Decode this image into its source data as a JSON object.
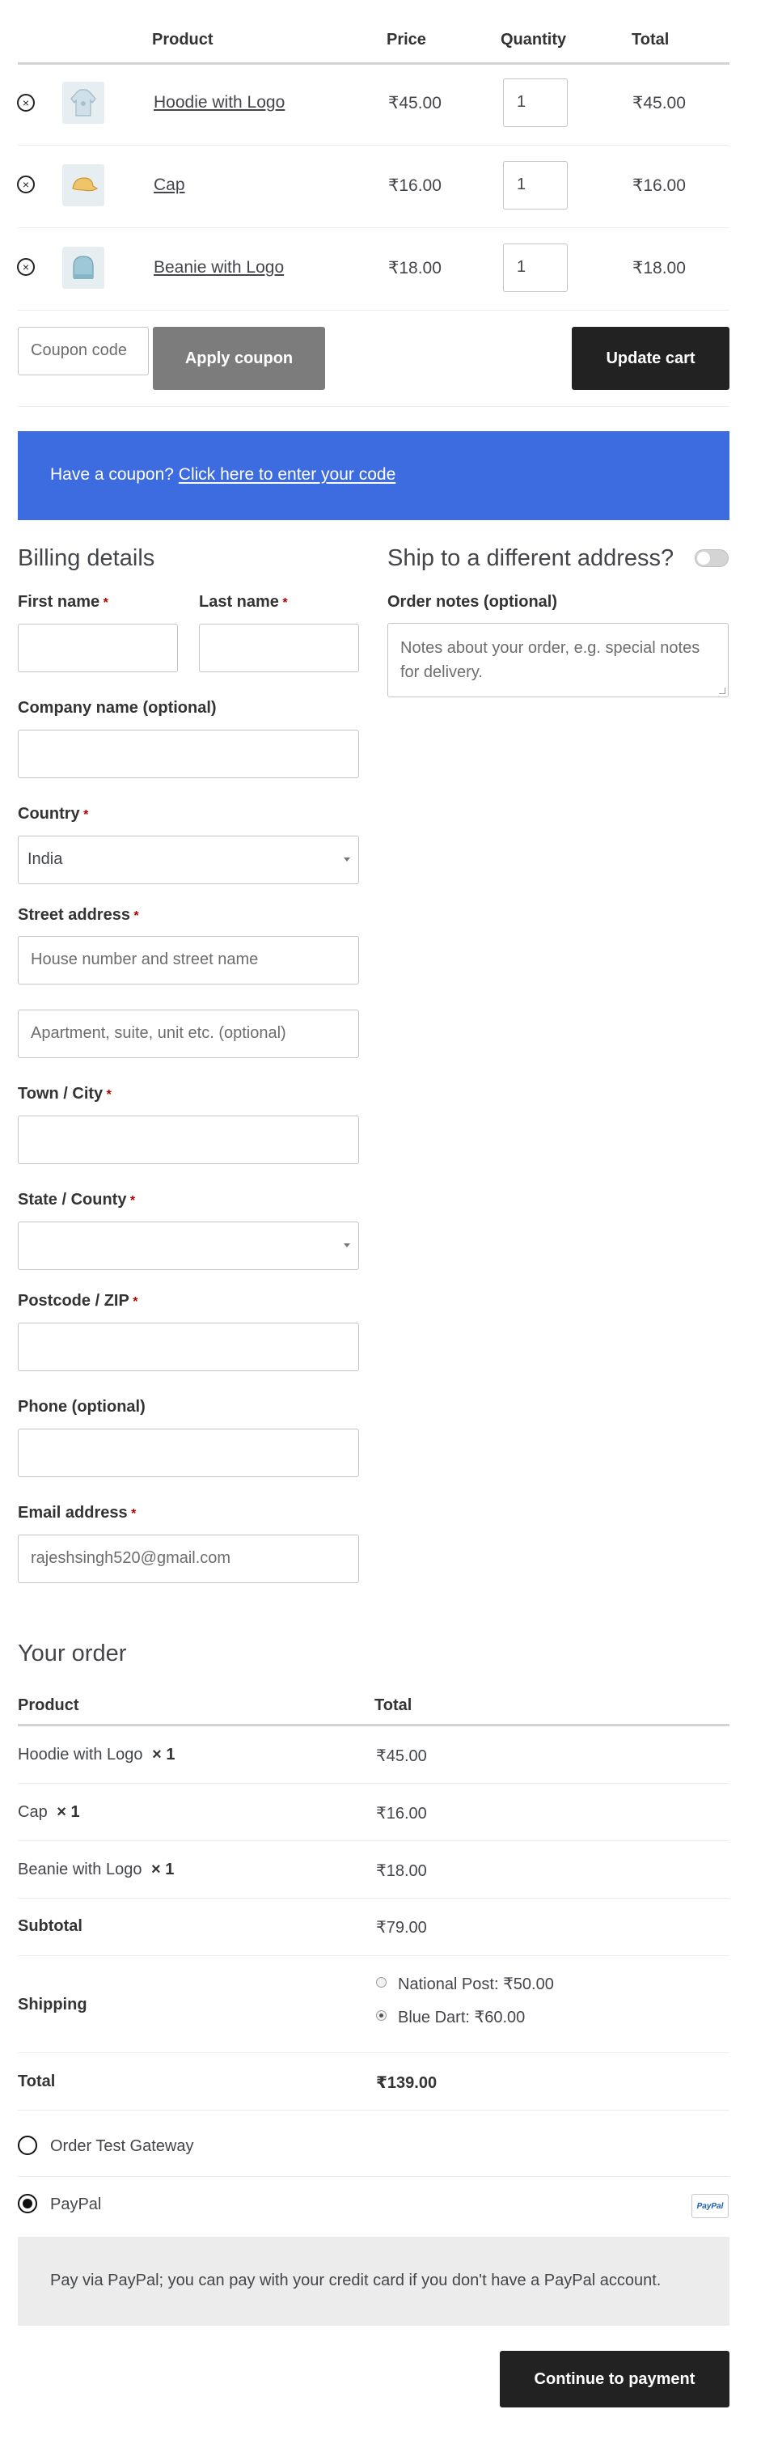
{
  "cart": {
    "headers": {
      "product": "Product",
      "price": "Price",
      "quantity": "Quantity",
      "total": "Total"
    },
    "items": [
      {
        "name": "Hoodie with Logo",
        "price": "₹45.00",
        "qty": "1",
        "total": "₹45.00",
        "thumb_icon": "hoodie-thumbnail"
      },
      {
        "name": "Cap",
        "price": "₹16.00",
        "qty": "1",
        "total": "₹16.00",
        "thumb_icon": "cap-thumbnail"
      },
      {
        "name": "Beanie with Logo",
        "price": "₹18.00",
        "qty": "1",
        "total": "₹18.00",
        "thumb_icon": "beanie-thumbnail"
      }
    ],
    "coupon_placeholder": "Coupon code",
    "apply_coupon_label": "Apply coupon",
    "update_cart_label": "Update cart"
  },
  "coupon_banner": {
    "text": "Have a coupon?",
    "link": "Click here to enter your code",
    "color": "#3d6be0"
  },
  "billing": {
    "title": "Billing details",
    "required_mark": "*",
    "first_name_label": "First name",
    "last_name_label": "Last name",
    "company_label": "Company name (optional)",
    "country_label": "Country",
    "country_value": "India",
    "street_label": "Street address",
    "street_placeholder_1": "House number and street name",
    "street_placeholder_2": "Apartment, suite, unit etc. (optional)",
    "city_label": "Town / City",
    "state_label": "State / County",
    "postcode_label": "Postcode / ZIP",
    "phone_label": "Phone (optional)",
    "email_label": "Email address",
    "email_value": "rajeshsingh520@gmail.com"
  },
  "shipping": {
    "ship_different_label": "Ship to a different address?",
    "order_notes_label": "Order notes (optional)",
    "order_notes_placeholder": "Notes about your order, e.g. special notes for delivery."
  },
  "order": {
    "title": "Your order",
    "headers": {
      "product": "Product",
      "total": "Total"
    },
    "items": [
      {
        "name": "Hoodie with Logo",
        "qty": "× 1",
        "total": "₹45.00"
      },
      {
        "name": "Cap",
        "qty": "× 1",
        "total": "₹16.00"
      },
      {
        "name": "Beanie with Logo",
        "qty": "× 1",
        "total": "₹18.00"
      }
    ],
    "subtotal_label": "Subtotal",
    "subtotal_value": "₹79.00",
    "shipping_label": "Shipping",
    "shipping_options": [
      {
        "label": "National Post: ₹50.00",
        "selected": false
      },
      {
        "label": "Blue Dart: ₹60.00",
        "selected": true
      }
    ],
    "total_label": "Total",
    "total_value": "₹139.00"
  },
  "payment": {
    "methods": [
      {
        "label": "Order Test Gateway",
        "selected": false
      },
      {
        "label": "PayPal",
        "selected": true,
        "badge": "PayPal"
      }
    ],
    "paypal_description": "Pay via PayPal; you can pay with your credit card if you don't have a PayPal account.",
    "continue_label": "Continue to payment"
  }
}
